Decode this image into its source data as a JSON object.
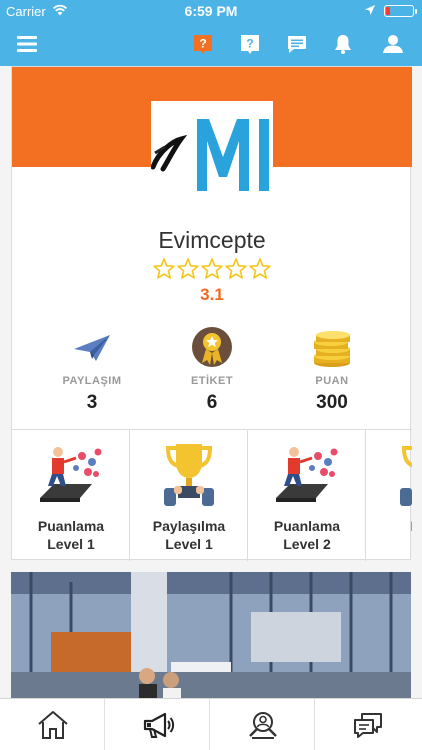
{
  "status_bar": {
    "carrier": "Carrier",
    "time": "6:59 PM",
    "battery_level": 0.15
  },
  "nav": {
    "icons": [
      "menu-icon",
      "company-question-icon",
      "question-icon",
      "messages-icon",
      "bell-icon",
      "user-icon"
    ],
    "accent": "#4cb3e6",
    "active_icon_color": "#f36f21"
  },
  "profile": {
    "name": "Evimcepte",
    "stars_max": 5,
    "stars_filled": 0,
    "rating": "3.1",
    "banner_color": "#f36f21"
  },
  "stats": [
    {
      "icon": "paper-plane-icon",
      "label": "PAYLAŞIM",
      "value": "3"
    },
    {
      "icon": "medal-icon",
      "label": "ETİKET",
      "value": "6"
    },
    {
      "icon": "coins-icon",
      "label": "PUAN",
      "value": "300"
    }
  ],
  "badges": [
    {
      "icon": "rating-level-icon",
      "name": "Puanlama",
      "level": "Level 1"
    },
    {
      "icon": "trophy-icon",
      "name": "Paylaşılma",
      "level": "Level 1"
    },
    {
      "icon": "rating-level-icon",
      "name": "Puanlama",
      "level": "Level 2"
    },
    {
      "icon": "trophy-icon",
      "name": "Payl",
      "level": "Lo"
    }
  ],
  "tabbar": {
    "tabs": [
      "home-icon",
      "megaphone-icon",
      "search-user-icon",
      "chat-icon"
    ]
  }
}
